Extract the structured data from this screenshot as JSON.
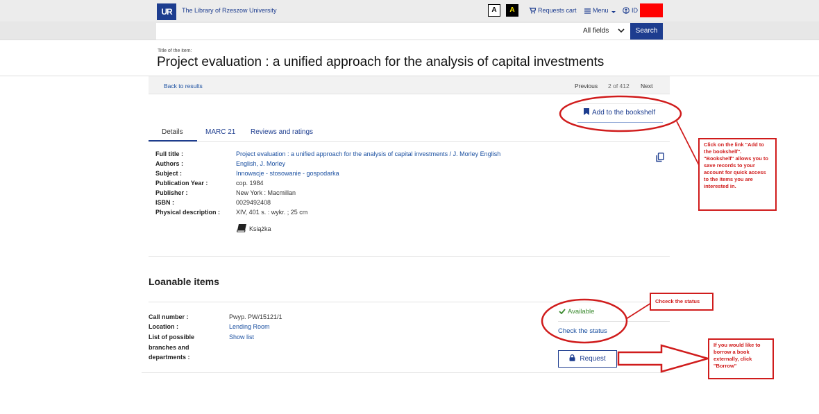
{
  "header": {
    "logo_text": "UR",
    "library_name": "The Library of Rzeszow University",
    "contrast_normal": "A",
    "contrast_high": "A",
    "requests_cart": "Requests cart",
    "menu": "Menu",
    "id_label": "ID"
  },
  "search": {
    "placeholder": "",
    "field_selected": "All fields",
    "button": "Search"
  },
  "record": {
    "title_caption": "Title of the item:",
    "title": "Project evaluation : a unified approach for the analysis of capital investments"
  },
  "nav": {
    "back": "Back to results",
    "previous": "Previous",
    "position": "2 of 412",
    "next": "Next"
  },
  "bookshelf": {
    "label": "Add to the bookshelf"
  },
  "tabs": [
    "Details",
    "MARC 21",
    "Reviews and ratings"
  ],
  "details": [
    {
      "label": "Full title :",
      "value": "Project evaluation : a unified approach for the analysis of capital investments / J. Morley English",
      "link": true
    },
    {
      "label": "Authors :",
      "value": "English, J. Morley",
      "link": true
    },
    {
      "label": "Subject :",
      "value": "Innowacje - stosowanie - gospodarka",
      "link": true
    },
    {
      "label": "Publication Year :",
      "value": "cop. 1984",
      "link": false
    },
    {
      "label": "Publisher :",
      "value": "New York : Macmillan",
      "link": false
    },
    {
      "label": "ISBN :",
      "value": "0029492408",
      "link": false
    },
    {
      "label": "Physical description :",
      "value": "XIV, 401 s. : wykr. ; 25 cm",
      "link": false
    }
  ],
  "format": {
    "label": "Książka"
  },
  "loanable": {
    "heading": "Loanable items",
    "call_number_label": "Call number :",
    "call_number": "Pwyp. PW/15121/1",
    "location_label": "Location :",
    "location": "Lending Room",
    "branches_label_1": "List of possible",
    "branches_label_2": "branches and",
    "branches_label_3": "departments :",
    "branches_value": "Show list",
    "status": "Available",
    "check_status": "Check the status",
    "request": "Request"
  },
  "annotations": {
    "note_bookshelf": "Click on the link \"Add to the bookshelf\". \"Bookshelf\" allows you to save records to your account for quick access to the items you are interested in.",
    "note_status": "Chceck the status",
    "note_borrow": "If you would like to borrow a book externally, click \"Borrow\""
  },
  "colors": {
    "brand": "#1d3d8f",
    "link": "#1a4fa0",
    "available": "#3a8a2e",
    "annotation": "#d01c1c",
    "redaction": "#ff0000"
  },
  "icons": [
    "cart-icon",
    "hamburger-icon",
    "user-icon",
    "chevron-down-icon",
    "bookmark-icon",
    "copy-icon",
    "book-icon",
    "check-icon",
    "lock-icon"
  ]
}
